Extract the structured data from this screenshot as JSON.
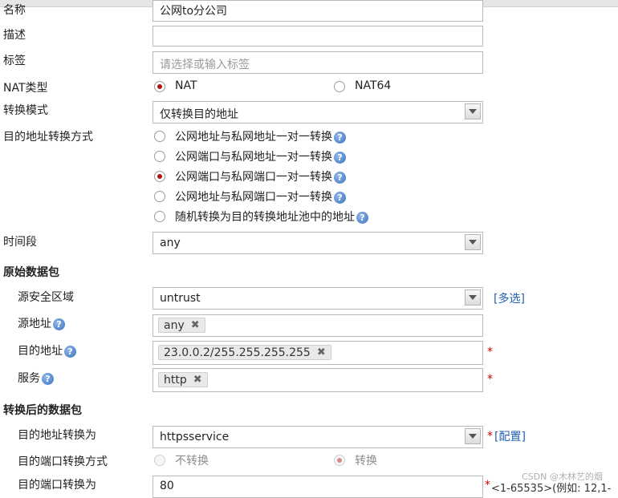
{
  "form": {
    "name": {
      "label": "名称",
      "value": "公网to分公司"
    },
    "description": {
      "label": "描述",
      "value": ""
    },
    "tags": {
      "label": "标签",
      "placeholder": "请选择或输入标签"
    },
    "nat_type": {
      "label": "NAT类型",
      "options": [
        "NAT",
        "NAT64"
      ],
      "selected": "NAT"
    },
    "mode": {
      "label": "转换模式",
      "value": "仅转换目的地址"
    },
    "dst_method": {
      "label": "目的地址转换方式",
      "options": [
        "公网地址与私网地址一对一转换",
        "公网端口与私网地址一对一转换",
        "公网端口与私网端口一对一转换",
        "公网地址与私网端口一对一转换",
        "随机转换为目的转换地址池中的地址"
      ],
      "selected": "公网端口与私网端口一对一转换"
    },
    "schedule": {
      "label": "时间段",
      "value": "any"
    }
  },
  "original_packet": {
    "section_title": "原始数据包",
    "src_zone": {
      "label": "源安全区域",
      "value": "untrust",
      "link": "[多选]"
    },
    "src_addr": {
      "label": "源地址",
      "tags": [
        "any"
      ]
    },
    "dst_addr": {
      "label": "目的地址",
      "tags": [
        "23.0.0.2/255.255.255.255"
      ],
      "required": "*"
    },
    "service": {
      "label": "服务",
      "tags": [
        "http"
      ],
      "required": "*"
    }
  },
  "translated_packet": {
    "section_title": "转换后的数据包",
    "dst_translate": {
      "label": "目的地址转换为",
      "value": "httpsservice",
      "required": "*",
      "link": "[配置]"
    },
    "port_method": {
      "label": "目的端口转换方式",
      "options": [
        "不转换",
        "转换"
      ],
      "selected": "转换"
    },
    "port_translate": {
      "label": "目的端口转换为",
      "value": "80",
      "required": "*",
      "hint": "<1-65535>(例如: 12,1-"
    }
  },
  "help_glyph": "?",
  "remove_glyph": "✖",
  "watermark": "CSDN @木林艺的烟",
  "icons": [
    "dropdown-arrow-icon",
    "help-icon",
    "remove-tag-icon"
  ],
  "colors": {
    "required": "#d40000",
    "link": "#1e5fb4",
    "radio_checked": "#b01515"
  }
}
